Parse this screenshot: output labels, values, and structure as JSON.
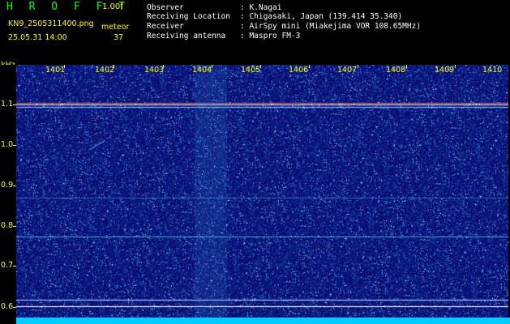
{
  "header": {
    "app_title": "H R O F F T",
    "version": "1.00f",
    "filename": "KN9_2505311400.png",
    "timestamp": "25.05.31 14:00",
    "meteor_label": "meteor",
    "meteor_count": "37",
    "info": [
      {
        "key": "Observer",
        "value": ": K.Nagai"
      },
      {
        "key": "Receiving Location",
        "value": ": Chigasaki, Japan (139.414 35.340)"
      },
      {
        "key": "Receiver",
        "value": ": AirSpy mini (Miakejima VOR 108.65MHz)"
      },
      {
        "key": "Receiving antenna",
        "value": ": Maspro FM-3"
      }
    ]
  },
  "spectrogram": {
    "y_unit": "kHz",
    "y_ticks": [
      "1.1",
      "1.0",
      "0.9",
      "0.8",
      "0.7",
      "0.6"
    ],
    "x_ticks": [
      "1401",
      "1402",
      "1403",
      "1404",
      "1405",
      "1406",
      "1407",
      "1408",
      "1409",
      "1410"
    ],
    "colors": {
      "background": "#0a0f72",
      "text_labels": "#ffff00",
      "bottom_bar": "#00ccff"
    }
  }
}
